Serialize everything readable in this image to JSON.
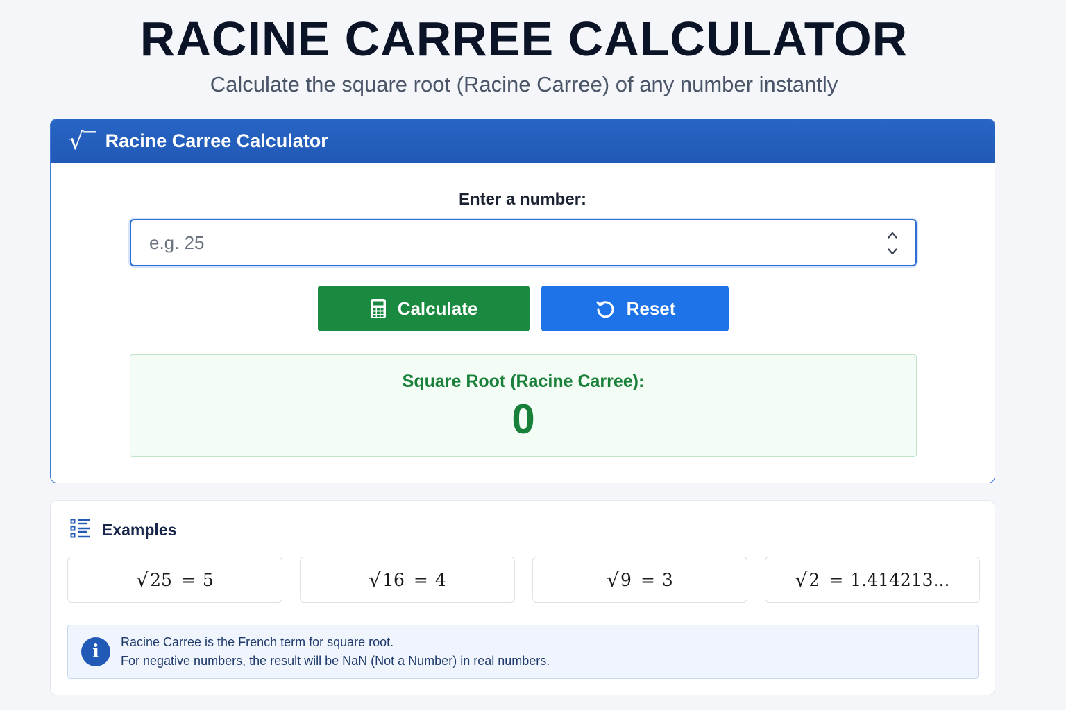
{
  "page": {
    "title": "RACINE CARREE CALCULATOR",
    "subtitle": "Calculate the square root (Racine Carree) of any number instantly"
  },
  "calculator": {
    "header_icon": "square-root-icon",
    "header_title": "Racine Carree Calculator",
    "input_label": "Enter a number:",
    "input_placeholder": "e.g. 25",
    "input_value": "",
    "calculate_label": "Calculate",
    "calculate_icon": "calculator-icon",
    "reset_label": "Reset",
    "reset_icon": "reset-icon",
    "result_label": "Square Root (Racine Carree):",
    "result_value": "0"
  },
  "examples": {
    "icon": "list-icon",
    "title": "Examples",
    "items": [
      {
        "radicand": "25",
        "result": "5"
      },
      {
        "radicand": "16",
        "result": "4"
      },
      {
        "radicand": "9",
        "result": "3"
      },
      {
        "radicand": "2",
        "result": "1.414213..."
      }
    ],
    "info_icon": "info-icon",
    "info_line1": "Racine Carree is the French term for square root.",
    "info_line2": "For negative numbers, the result will be NaN (Not a Number) in real numbers."
  },
  "colors": {
    "header_blue": "#2159b6",
    "calculate_green": "#1a8a40",
    "reset_blue": "#1f73e8",
    "result_green": "#198039"
  }
}
